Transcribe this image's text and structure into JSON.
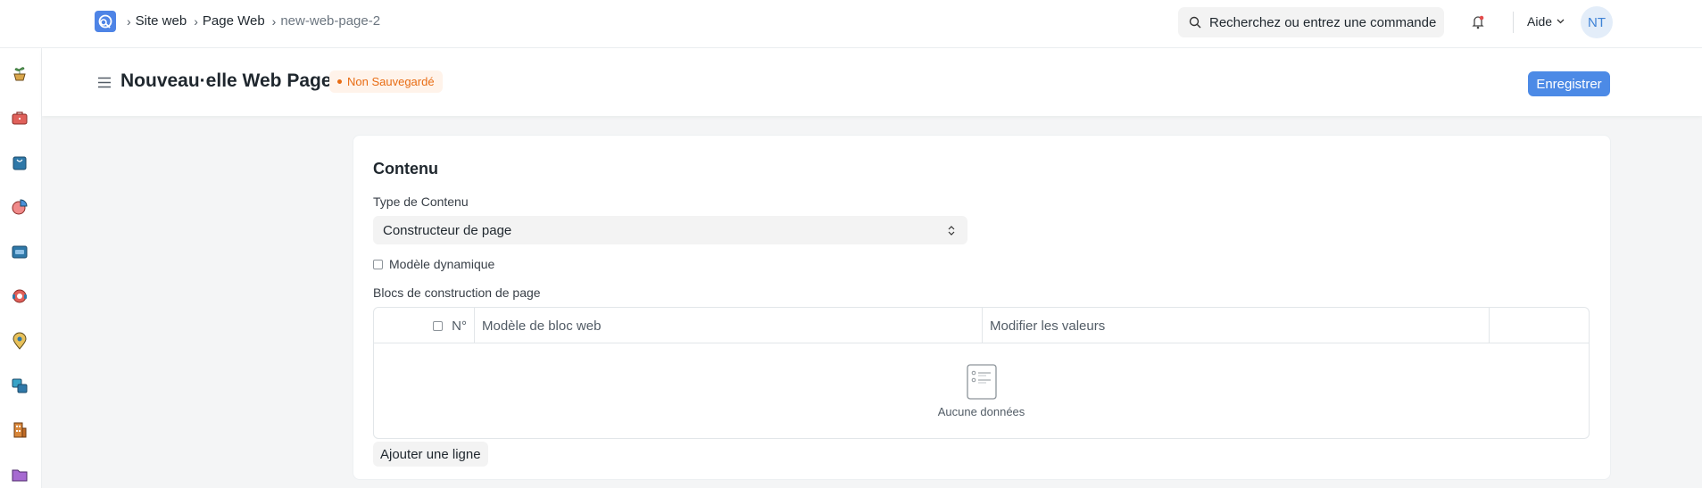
{
  "navbar": {
    "breadcrumbs": [
      "Site web",
      "Page Web",
      "new-web-page-2"
    ],
    "search_placeholder": "Recherchez ou entrez une commande",
    "help_label": "Aide",
    "avatar_initials": "NT"
  },
  "rail": {
    "icons": [
      "plant-icon",
      "briefcase-icon",
      "shopping-bag-icon",
      "pie-chart-icon",
      "wallet-icon",
      "support-icon",
      "map-pin-icon",
      "layers-icon",
      "building-icon",
      "folder-icon"
    ]
  },
  "page": {
    "title": "Nouveau·elle Web Page",
    "status_badge": "Non Sauvegardé",
    "save_label": "Enregistrer"
  },
  "form": {
    "section_title": "Contenu",
    "content_type_label": "Type de Contenu",
    "content_type_value": "Constructeur de page",
    "dynamic_template_label": "Modèle dynamique",
    "blocks_label": "Blocs de construction de page",
    "table": {
      "columns": [
        "N°",
        "Modèle de bloc web",
        "Modifier les valeurs"
      ],
      "empty_text": "Aucune données"
    },
    "add_row_label": "Ajouter une ligne"
  },
  "colors": {
    "primary": "#4c8ae6",
    "badge_text": "#e86c13",
    "badge_bg": "#fff3ea"
  }
}
